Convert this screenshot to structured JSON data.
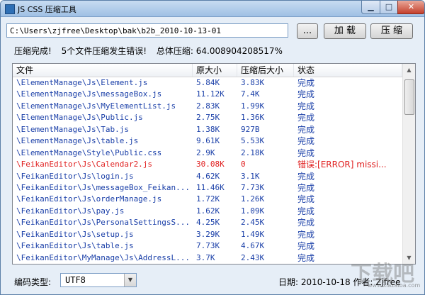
{
  "window": {
    "title": "JS CSS 压缩工具",
    "controls": {
      "minimize": "▁",
      "maximize": "□",
      "close": "✕"
    }
  },
  "toolbar": {
    "path_value": "C:\\Users\\zjfree\\Desktop\\bak\\b2b_2010-10-13-01",
    "browse_label": "...",
    "load_label": "加 载",
    "compress_label": "压 缩"
  },
  "status": {
    "done": "压缩完成!",
    "errors": "5个文件压缩发生错误!",
    "ratio": "总体压缩: 64.008904208517%"
  },
  "list": {
    "columns": [
      "文件",
      "原大小",
      "压缩后大小",
      "状态"
    ],
    "rows": [
      {
        "file": "\\ElementManage\\Js\\Element.js",
        "orig": "5.84K",
        "comp": "3.83K",
        "status": "完成",
        "error": false
      },
      {
        "file": "\\ElementManage\\Js\\messageBox.js",
        "orig": "11.12K",
        "comp": "7.4K",
        "status": "完成",
        "error": false
      },
      {
        "file": "\\ElementManage\\Js\\MyElementList.js",
        "orig": "2.83K",
        "comp": "1.99K",
        "status": "完成",
        "error": false
      },
      {
        "file": "\\ElementManage\\Js\\Public.js",
        "orig": "2.75K",
        "comp": "1.36K",
        "status": "完成",
        "error": false
      },
      {
        "file": "\\ElementManage\\Js\\Tab.js",
        "orig": "1.38K",
        "comp": "927B",
        "status": "完成",
        "error": false
      },
      {
        "file": "\\ElementManage\\Js\\table.js",
        "orig": "9.61K",
        "comp": "5.53K",
        "status": "完成",
        "error": false
      },
      {
        "file": "\\ElementManage\\Style\\Public.css",
        "orig": "2.9K",
        "comp": "2.18K",
        "status": "完成",
        "error": false
      },
      {
        "file": "\\FeikanEditor\\Js\\Calendar2.js",
        "orig": "30.08K",
        "comp": "0",
        "status": "错误:[ERROR] missi...",
        "error": true
      },
      {
        "file": "\\FeikanEditor\\Js\\login.js",
        "orig": "4.62K",
        "comp": "3.1K",
        "status": "完成",
        "error": false
      },
      {
        "file": "\\FeikanEditor\\Js\\messageBox_Feikan...",
        "orig": "11.46K",
        "comp": "7.73K",
        "status": "完成",
        "error": false
      },
      {
        "file": "\\FeikanEditor\\Js\\orderManage.js",
        "orig": "1.72K",
        "comp": "1.26K",
        "status": "完成",
        "error": false
      },
      {
        "file": "\\FeikanEditor\\Js\\pay.js",
        "orig": "1.62K",
        "comp": "1.09K",
        "status": "完成",
        "error": false
      },
      {
        "file": "\\FeikanEditor\\Js\\PersonalSettingsS...",
        "orig": "4.25K",
        "comp": "2.45K",
        "status": "完成",
        "error": false
      },
      {
        "file": "\\FeikanEditor\\Js\\setup.js",
        "orig": "3.29K",
        "comp": "1.49K",
        "status": "完成",
        "error": false
      },
      {
        "file": "\\FeikanEditor\\Js\\table.js",
        "orig": "7.73K",
        "comp": "4.67K",
        "status": "完成",
        "error": false
      },
      {
        "file": "\\FeikanEditor\\MyManage\\Js\\AddressL...",
        "orig": "3.7K",
        "comp": "2.43K",
        "status": "完成",
        "error": false
      }
    ]
  },
  "scrollbar": {
    "up": "▲",
    "down": "▼"
  },
  "encoding": {
    "label": "编码类型:",
    "value": "UTF8",
    "arrow": "▼"
  },
  "footer": {
    "info": "日期: 2010-10-18 作者: Zjfree"
  },
  "watermark": {
    "logo": "下载吧",
    "url": "www.xiazaiba.com"
  },
  "colors": {
    "link_blue": "#1a3fa8",
    "error_red": "#e02020",
    "title_gradient": "#9fc0e4"
  }
}
